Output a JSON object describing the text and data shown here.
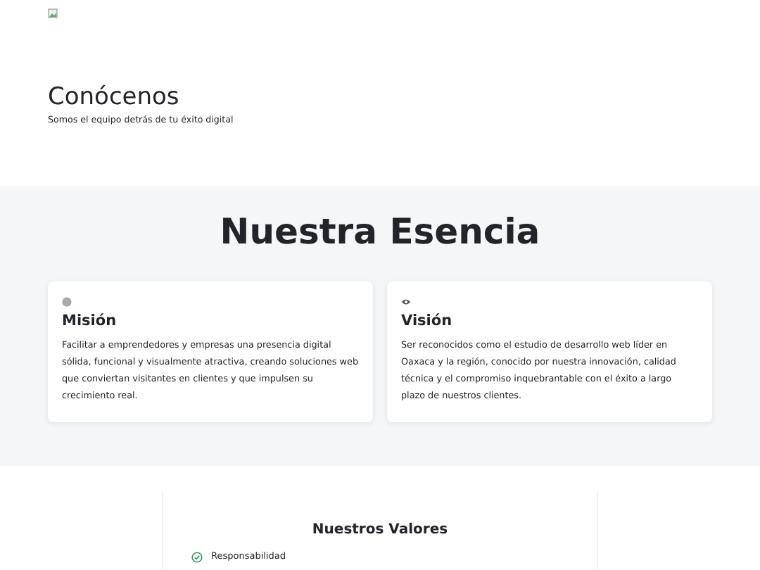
{
  "hero": {
    "title": "Conócenos",
    "subtitle": "Somos el equipo detrás de tu éxito digital"
  },
  "essence": {
    "title": "Nuestra Esencia",
    "cards": [
      {
        "kind": "dot",
        "title": "Misión",
        "text": "Facilitar a emprendedores y empresas una presencia digital sólida, funcional y visualmente atractiva, creando soluciones web que conviertan visitantes en clientes y que impulsen su crecimiento real."
      },
      {
        "kind": "eye",
        "title": "Visión",
        "text": "Ser reconocidos como el estudio de desarrollo web líder en Oaxaca y la región, conocido por nuestra innovación, calidad técnica y el compromiso inquebrantable con el éxito a largo plazo de nuestros clientes."
      }
    ]
  },
  "values": {
    "title": "Nuestros Valores",
    "items": [
      "Responsabilidad"
    ]
  }
}
